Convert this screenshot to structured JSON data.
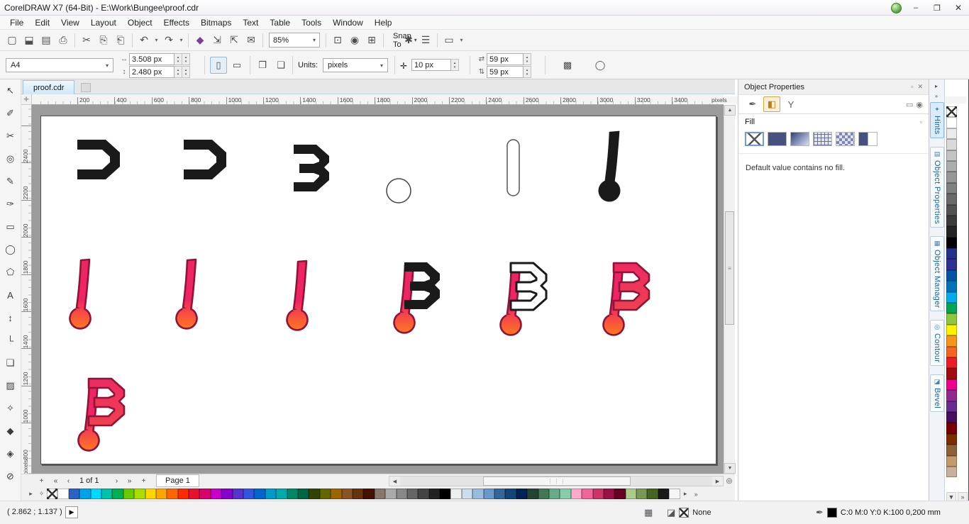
{
  "window": {
    "title": "CorelDRAW X7 (64-Bit) - E:\\Work\\Bungee\\proof.cdr"
  },
  "menu": {
    "items": [
      {
        "name": "menu-file",
        "label": "File"
      },
      {
        "name": "menu-edit",
        "label": "Edit"
      },
      {
        "name": "menu-view",
        "label": "View"
      },
      {
        "name": "menu-layout",
        "label": "Layout"
      },
      {
        "name": "menu-object",
        "label": "Object"
      },
      {
        "name": "menu-effects",
        "label": "Effects"
      },
      {
        "name": "menu-bitmaps",
        "label": "Bitmaps"
      },
      {
        "name": "menu-text",
        "label": "Text"
      },
      {
        "name": "menu-table",
        "label": "Table"
      },
      {
        "name": "menu-tools",
        "label": "Tools"
      },
      {
        "name": "menu-window",
        "label": "Window"
      },
      {
        "name": "menu-help",
        "label": "Help"
      }
    ]
  },
  "toolbar": {
    "zoom": "85%",
    "snap_label": "Snap To",
    "buttons_left": [
      {
        "name": "new-document-button",
        "glyph": "▢"
      },
      {
        "name": "open-button",
        "glyph": "⬓"
      },
      {
        "name": "save-button",
        "glyph": "▤"
      },
      {
        "name": "print-button",
        "glyph": "⎙"
      },
      {
        "name": "toolbar-separator",
        "glyph": ""
      },
      {
        "name": "cut-button",
        "glyph": "✂"
      },
      {
        "name": "copy-button",
        "glyph": "⎘"
      },
      {
        "name": "paste-button",
        "glyph": "⎗"
      },
      {
        "name": "toolbar-separator",
        "glyph": ""
      },
      {
        "name": "undo-button",
        "glyph": "↶"
      },
      {
        "name": "undo-dropdown",
        "glyph": "▾"
      },
      {
        "name": "redo-button",
        "glyph": "↷"
      },
      {
        "name": "redo-dropdown",
        "glyph": "▾"
      },
      {
        "name": "toolbar-separator",
        "glyph": ""
      },
      {
        "name": "application-launcher-button",
        "glyph": "◆"
      },
      {
        "name": "import-button",
        "glyph": "⇲"
      },
      {
        "name": "export-button",
        "glyph": "⇱"
      },
      {
        "name": "publish-pdf-button",
        "glyph": "✉"
      },
      {
        "name": "toolbar-separator",
        "glyph": ""
      }
    ],
    "buttons_mid": [
      {
        "name": "toolbar-separator",
        "glyph": ""
      },
      {
        "name": "fullscreen-preview-button",
        "glyph": "⊡"
      },
      {
        "name": "preview-button",
        "glyph": "◉"
      },
      {
        "name": "show-grid-button",
        "glyph": "⊞"
      },
      {
        "name": "toolbar-separator",
        "glyph": ""
      }
    ],
    "buttons_right": [
      {
        "name": "options-button",
        "glyph": "✱"
      },
      {
        "name": "application-bars-button",
        "glyph": "☰"
      },
      {
        "name": "toolbar-separator",
        "glyph": ""
      },
      {
        "name": "workspace-button",
        "glyph": "▭"
      },
      {
        "name": "workspace-dropdown",
        "glyph": "▾"
      }
    ]
  },
  "propbar": {
    "preset": "A4",
    "width": "3.508 px",
    "height": "2.480 px",
    "units_label": "Units:",
    "units": "pixels",
    "nudge": "10 px",
    "dup_x": "59 px",
    "dup_y": "59 px"
  },
  "doc_tab": {
    "label": "proof.cdr"
  },
  "rulers": {
    "h_numbers": [
      "200",
      "400",
      "600",
      "800",
      "1000",
      "1200",
      "1400",
      "1600",
      "1800",
      "2000",
      "2200",
      "2400",
      "2600",
      "2800",
      "3000",
      "3200",
      "3400"
    ],
    "v_numbers": [
      "2400",
      "2200",
      "2000",
      "1800",
      "1600",
      "1400",
      "1200",
      "1000",
      "800"
    ],
    "h_unit": "pixels",
    "v_unit": "pixels"
  },
  "toolbox": {
    "tools": [
      {
        "name": "pick-tool",
        "glyph": "↖"
      },
      {
        "name": "shape-tool",
        "glyph": "✐"
      },
      {
        "name": "crop-tool",
        "glyph": "✂"
      },
      {
        "name": "zoom-tool",
        "glyph": "◎"
      },
      {
        "name": "freehand-tool",
        "glyph": "✎"
      },
      {
        "name": "artistic-media-tool",
        "glyph": "✑"
      },
      {
        "name": "rectangle-tool",
        "glyph": "▭"
      },
      {
        "name": "ellipse-tool",
        "glyph": "◯"
      },
      {
        "name": "polygon-tool",
        "glyph": "⬠"
      },
      {
        "name": "text-tool",
        "glyph": "A"
      },
      {
        "name": "parallel-dimension-tool",
        "glyph": "↕"
      },
      {
        "name": "connector-tool",
        "glyph": "└"
      },
      {
        "name": "drop-shadow-tool",
        "glyph": "❏"
      },
      {
        "name": "transparency-tool",
        "glyph": "▨"
      },
      {
        "name": "color-eyedropper-tool",
        "glyph": "✧"
      },
      {
        "name": "interactive-fill-tool",
        "glyph": "◆"
      },
      {
        "name": "smart-fill-tool",
        "glyph": "◈"
      },
      {
        "name": "outline-pen-tool",
        "glyph": "⊘"
      }
    ]
  },
  "docker": {
    "title": "Object Properties",
    "section": "Fill",
    "message": "Default value contains no fill.",
    "tabs": [
      {
        "name": "docker-tab-hints",
        "label": "Hints",
        "icon": "✦"
      },
      {
        "name": "docker-tab-object-properties",
        "label": "Object Properties",
        "icon": "▤"
      },
      {
        "name": "docker-tab-object-manager",
        "label": "Object Manager",
        "icon": "▦"
      },
      {
        "name": "docker-tab-contour",
        "label": "Contour",
        "icon": "◎"
      },
      {
        "name": "docker-tab-bevel",
        "label": "Bevel",
        "icon": "◪"
      }
    ]
  },
  "page_nav": {
    "label": "1 of 1",
    "tab": "Page 1"
  },
  "status_bar": {
    "coords": "( 2.862 ; 1.137 )",
    "fill_label": "None",
    "outline_text": "C:0 M:0 Y:0 K:100 0,200 mm"
  },
  "icons": {
    "minimize": "–",
    "maximize": "❐",
    "close": "✕",
    "dropdown": "▾",
    "spin_up": "▴",
    "spin_down": "▾",
    "paper_width": "↔",
    "paper_height": "↕",
    "portrait": "▯",
    "landscape": "▭",
    "all_pages": "❐",
    "current_page": "❏",
    "nudge": "✛",
    "dup_x": "⇄",
    "dup_y": "⇅",
    "treat_filled": "▩",
    "outline_circle": "◯",
    "ruler_origin": "✛",
    "scroll_up": "▲",
    "scroll_down": "▼",
    "scroll_left": "◀",
    "scroll_right": "▶",
    "first_page": "«",
    "prev_page": "‹",
    "next_page": "›",
    "last_page": "»",
    "add_page": "+",
    "zoom_fit": "◎",
    "thumb_grip": "⋮⋮⋮",
    "flyout": "▸",
    "overflow": "»",
    "play": "▶",
    "tablet": "▦",
    "fill_bucket": "◪",
    "outline_pen": "✒",
    "pin": "▫",
    "close_small": "✕",
    "docker_outline_tab": "✒",
    "docker_fill_tab": "◧",
    "docker_transparency_tab": "Y",
    "docker_frame": "▭",
    "docker_eye": "◉",
    "eyedropper": "✧"
  },
  "colors": {
    "note_pink": "#ee2464",
    "note_orange": "#ff7a1f",
    "note_outline": "#8f1538",
    "glyph_black": "#1a1a1a",
    "tab_active": "#cfe8f7",
    "accent_blue": "#1a66a0",
    "canvas_gray": "#9b9b9b"
  },
  "palettes": {
    "bottom": [
      "none",
      "#FFFFFF",
      "#2B63C1",
      "#00A2E8",
      "#00D9FF",
      "#00C2A8",
      "#00B050",
      "#66CC00",
      "#AADD00",
      "#FFD700",
      "#FFA500",
      "#FF6600",
      "#FF2A00",
      "#E8112D",
      "#D6006E",
      "#C800C8",
      "#8800CC",
      "#5533CC",
      "#3355DD",
      "#0066CC",
      "#0099CC",
      "#00AAAA",
      "#008866",
      "#006644",
      "#334400",
      "#666600",
      "#996600",
      "#885522",
      "#663311",
      "#441100",
      "#887766",
      "#AAAAAA",
      "#888888",
      "#666666",
      "#444444",
      "#222222",
      "#000000",
      "#EEEEEE",
      "#CCDDEE",
      "#99BBDD",
      "#6699CC",
      "#336699",
      "#114477",
      "#002255",
      "#224433",
      "#447755",
      "#66AA88",
      "#88CCAA",
      "#FFAACC",
      "#EE6699",
      "#CC3366",
      "#991144",
      "#660022",
      "#AACC88",
      "#779955",
      "#446622",
      "#1A1A1A",
      "#F5F5F5"
    ],
    "right": [
      "none",
      "#FFFFFF",
      "#EBEBEB",
      "#D9D9D9",
      "#C4C4C4",
      "#ADADAD",
      "#969696",
      "#808080",
      "#696969",
      "#525252",
      "#3B3B3B",
      "#242424",
      "#000000",
      "#22318E",
      "#2E3192",
      "#0054A6",
      "#0072BC",
      "#00AEEF",
      "#00A651",
      "#8DC63F",
      "#FFF200",
      "#F7941D",
      "#F26522",
      "#ED1C24",
      "#9E0B0F",
      "#EC008C",
      "#92278F",
      "#662D91",
      "#440E62",
      "#790000",
      "#7B2E00",
      "#8C6239",
      "#C49A6C",
      "#C7B299"
    ]
  }
}
